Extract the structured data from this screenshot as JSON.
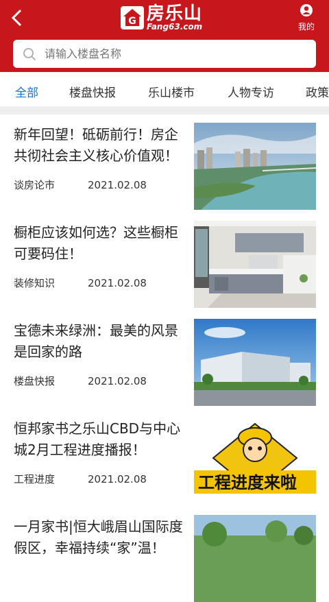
{
  "header": {
    "logo_cn": "房乐山",
    "logo_en": "Fang63.com",
    "mine_label": "我的"
  },
  "search": {
    "placeholder": "请输入楼盘名称"
  },
  "tabs": [
    {
      "label": "全部"
    },
    {
      "label": "楼盘快报"
    },
    {
      "label": "乐山楼市"
    },
    {
      "label": "人物专访"
    },
    {
      "label": "政策"
    }
  ],
  "articles": [
    {
      "title": "新年回望！砥砺前行！房企共彻社会主义核心价值观！",
      "category": "谈房论市",
      "date": "2021.02.08"
    },
    {
      "title": "橱柜应该如何选？这些橱柜可要码住！",
      "category": "装修知识",
      "date": "2021.02.08"
    },
    {
      "title": "宝德未来绿洲：最美的风景是回家的路",
      "category": "楼盘快报",
      "date": "2021.02.08"
    },
    {
      "title": "恒邦家书之乐山CBD与中心城2月工程进度播报！",
      "category": "工程进度",
      "date": "2021.02.08",
      "thumb_text": "工程进度来啦"
    },
    {
      "title": "一月家书|恒大峨眉山国际度假区，幸福持续“家”温！",
      "category": "",
      "date": ""
    }
  ],
  "colors": {
    "brand": "#c8161d",
    "active_tab": "#1e73c9"
  }
}
